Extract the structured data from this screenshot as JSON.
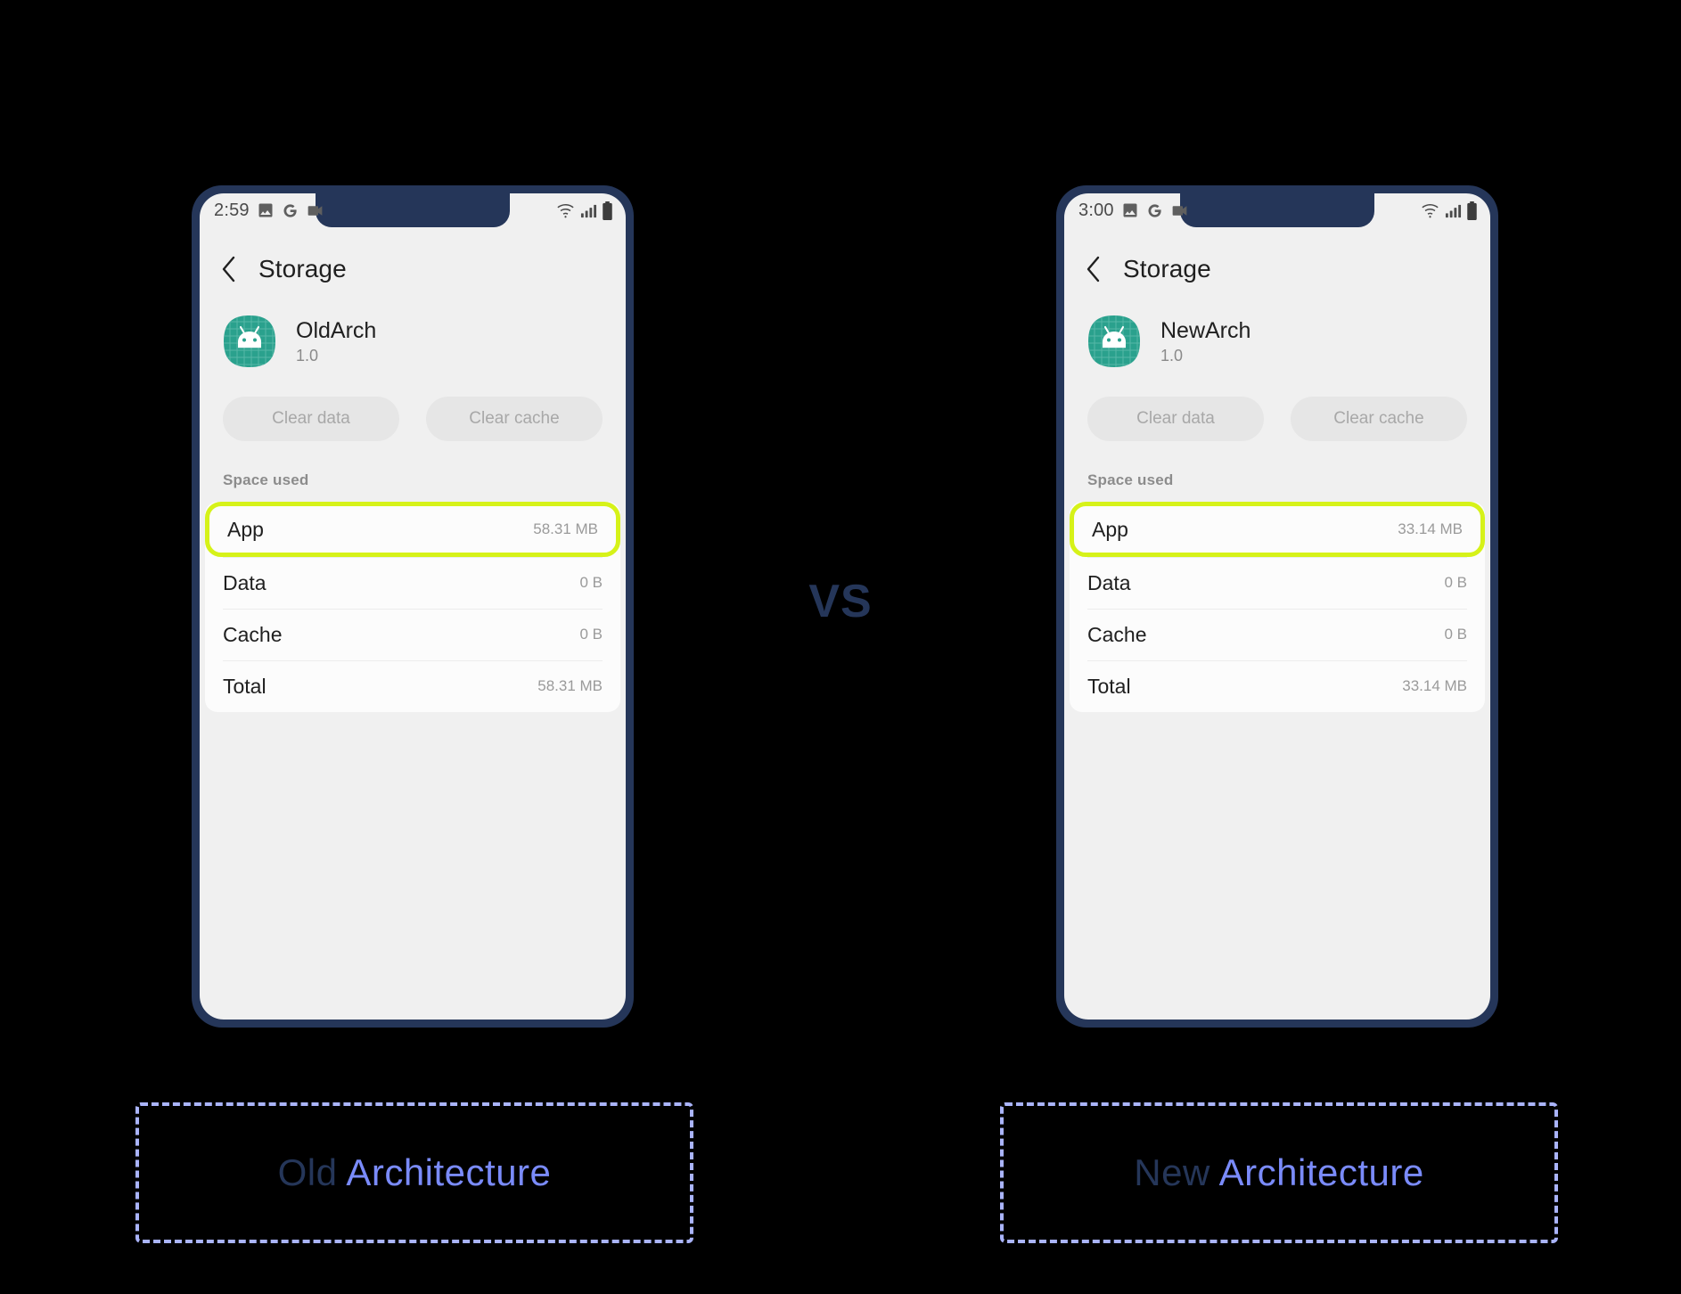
{
  "comparison": {
    "vs_label": "VS"
  },
  "phones": [
    {
      "side": "left",
      "status": {
        "time": "2:59",
        "icons_left": [
          "image-icon",
          "google-icon",
          "video-camera-icon"
        ],
        "icons_right": [
          "wifi-icon",
          "cellular-signal-icon",
          "battery-icon"
        ]
      },
      "appbar": {
        "back_icon": "chevron-left-icon",
        "title": "Storage"
      },
      "app": {
        "icon": "android-robot-icon",
        "name": "OldArch",
        "version": "1.0"
      },
      "actions": {
        "clear_data": "Clear data",
        "clear_cache": "Clear cache"
      },
      "space_used": {
        "section_label": "Space used",
        "rows": [
          {
            "label": "App",
            "value": "58.31 MB",
            "highlighted": true
          },
          {
            "label": "Data",
            "value": "0 B",
            "highlighted": false
          },
          {
            "label": "Cache",
            "value": "0 B",
            "highlighted": false
          },
          {
            "label": "Total",
            "value": "58.31 MB",
            "highlighted": false
          }
        ]
      },
      "caption": {
        "word1": "Old",
        "word2": "Architecture"
      }
    },
    {
      "side": "right",
      "status": {
        "time": "3:00",
        "icons_left": [
          "image-icon",
          "google-icon",
          "video-camera-icon"
        ],
        "icons_right": [
          "wifi-icon",
          "cellular-signal-icon",
          "battery-icon"
        ]
      },
      "appbar": {
        "back_icon": "chevron-left-icon",
        "title": "Storage"
      },
      "app": {
        "icon": "android-robot-icon",
        "name": "NewArch",
        "version": "1.0"
      },
      "actions": {
        "clear_data": "Clear data",
        "clear_cache": "Clear cache"
      },
      "space_used": {
        "section_label": "Space used",
        "rows": [
          {
            "label": "App",
            "value": "33.14 MB",
            "highlighted": true
          },
          {
            "label": "Data",
            "value": "0 B",
            "highlighted": false
          },
          {
            "label": "Cache",
            "value": "0 B",
            "highlighted": false
          },
          {
            "label": "Total",
            "value": "33.14 MB",
            "highlighted": false
          }
        ]
      },
      "caption": {
        "word1": "New",
        "word2": "Architecture"
      }
    }
  ],
  "colors": {
    "background": "#000000",
    "phone_frame": "#253659",
    "screen_bg": "#f0f0f0",
    "card_bg": "#fcfcfc",
    "highlight": "#d6f219",
    "accent_navy": "#253659",
    "accent_periwinkle": "#7a8bfb",
    "dashed_border": "#aab4fb",
    "app_icon_teal": "#2aa18d"
  }
}
